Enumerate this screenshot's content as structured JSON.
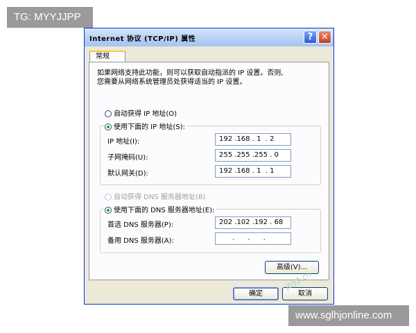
{
  "overlays": {
    "top_left_tag": "TG: MYYJJPP",
    "bottom_right_tag": "www.sglhjonline.com"
  },
  "window": {
    "title": "Internet 协议 (TCP/IP) 属性",
    "help_label": "?",
    "close_label": "✕"
  },
  "tab": {
    "label": "常规"
  },
  "description": "如果网络支持此功能，则可以获取自动指派的 IP 设置。否则,\n您需要从网络系统管理员处获得适当的 IP 设置。",
  "ip": {
    "auto_label": "自动获得 IP 地址(O)",
    "manual_label": "使用下面的 IP 地址(S):",
    "mode": "manual",
    "fields": [
      {
        "label": "IP 地址(I):",
        "value": "192 .168 . 1  . 2"
      },
      {
        "label": "子网掩码(U):",
        "value": "255 .255 .255 . 0"
      },
      {
        "label": "默认网关(D):",
        "value": "192 .168 . 1  . 1"
      }
    ]
  },
  "dns": {
    "auto_label": "自动获得 DNS 服务器地址(B)",
    "manual_label": "使用下面的 DNS 服务器地址(E):",
    "mode": "manual",
    "fields": [
      {
        "label": "首选 DNS 服务器(P):",
        "value": "202 .102 .192 . 68"
      },
      {
        "label": "备用 DNS 服务器(A):",
        "value": "      .      .      ."
      }
    ]
  },
  "buttons": {
    "advanced": "高级(V)...",
    "ok": "确定",
    "cancel": "取消"
  },
  "watermark": "jb51.cn"
}
